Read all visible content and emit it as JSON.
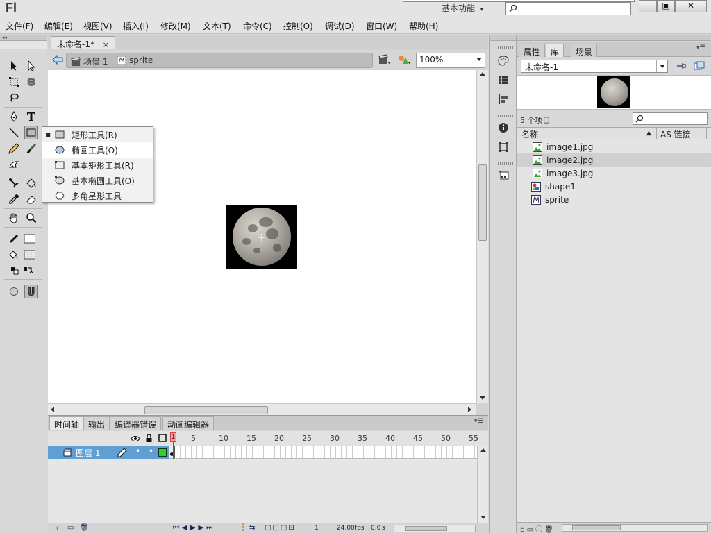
{
  "app": {
    "logo": "Fl",
    "workspace": "基本功能"
  },
  "window_controls": {
    "minimize": "—",
    "restore": "▣",
    "close": "✕"
  },
  "menu": [
    "文件(F)",
    "编辑(E)",
    "视图(V)",
    "插入(I)",
    "修改(M)",
    "文本(T)",
    "命令(C)",
    "控制(O)",
    "调试(D)",
    "窗口(W)",
    "帮助(H)"
  ],
  "document": {
    "tab_title": "未命名-1*",
    "tab_close": "×"
  },
  "breadcrumb": {
    "scene": "场景 1",
    "symbol": "sprite"
  },
  "zoom": "100%",
  "shape_menu": [
    {
      "label": "矩形工具(R)",
      "current": true,
      "icon": "rectangle-icon"
    },
    {
      "label": "椭圆工具(O)",
      "current": false,
      "highlighted": true,
      "icon": "oval-icon"
    },
    {
      "label": "基本矩形工具(R)",
      "current": false,
      "icon": "primitive-rectangle-icon"
    },
    {
      "label": "基本椭圆工具(O)",
      "current": false,
      "icon": "primitive-oval-icon"
    },
    {
      "label": "多角星形工具",
      "current": false,
      "icon": "polystar-icon"
    }
  ],
  "timeline": {
    "tabs": [
      "时间轴",
      "输出",
      "编译器错误",
      "动画编辑器"
    ],
    "frame_labels": [
      "1",
      "5",
      "10",
      "15",
      "20",
      "25",
      "30",
      "35",
      "40",
      "45",
      "50",
      "55"
    ],
    "layer_name": "图层 1",
    "footer": {
      "current_frame": "1",
      "fps": "24.00",
      "fps_unit": "fps",
      "time": "0.0",
      "time_unit": "s"
    }
  },
  "library": {
    "tabs": [
      "属性",
      "库",
      "场景"
    ],
    "active_tab": "库",
    "document": "未命名-1",
    "item_count": "5 个项目",
    "col_name": "名称",
    "col_linkage": "AS 链接",
    "items": [
      {
        "name": "image1.jpg",
        "type": "bitmap",
        "selected": false
      },
      {
        "name": "image2.jpg",
        "type": "bitmap",
        "selected": true
      },
      {
        "name": "image3.jpg",
        "type": "bitmap",
        "selected": false
      },
      {
        "name": "shape1",
        "type": "graphic",
        "selected": false
      },
      {
        "name": "sprite",
        "type": "movieclip",
        "selected": false
      }
    ]
  }
}
